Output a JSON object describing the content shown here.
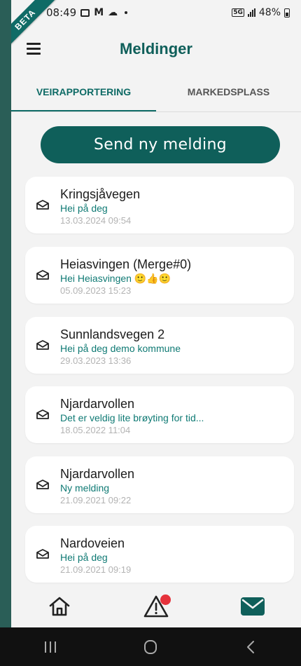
{
  "status_bar": {
    "time": "08:49",
    "battery": "48%",
    "network": "5G"
  },
  "beta_label": "BETA",
  "header": {
    "title": "Meldinger"
  },
  "tabs": [
    {
      "label": "VEIRAPPORTERING",
      "active": true
    },
    {
      "label": "MARKEDSPLASS",
      "active": false
    }
  ],
  "send_button": {
    "label": "Send ny melding"
  },
  "messages": [
    {
      "title": "Kringsjåvegen",
      "preview": "Hei på deg",
      "date": "13.03.2024 09:54"
    },
    {
      "title": "Heiasvingen (Merge#0)",
      "preview": "Hei Heiasvingen 🙂👍🙂",
      "date": "05.09.2023 15:23"
    },
    {
      "title": "Sunnlandsvegen 2",
      "preview": "Hei på deg demo kommune",
      "date": "29.03.2023 13:36"
    },
    {
      "title": "Njardarvollen",
      "preview": "Det er veldig lite brøyting for tid...",
      "date": "18.05.2022 11:04"
    },
    {
      "title": "Njardarvollen",
      "preview": "Ny melding",
      "date": "21.09.2021 09:22"
    },
    {
      "title": "Nardoveien",
      "preview": "Hei på deg",
      "date": "21.09.2021 09:19"
    }
  ],
  "bottom_nav": [
    {
      "icon": "home-icon"
    },
    {
      "icon": "warning-icon",
      "has_badge": true
    },
    {
      "icon": "mail-icon",
      "active": true
    }
  ],
  "colors": {
    "primary": "#0f5f5a",
    "accent": "#0f7a74",
    "badge": "#e5323b",
    "background": "#f3f3f3"
  }
}
